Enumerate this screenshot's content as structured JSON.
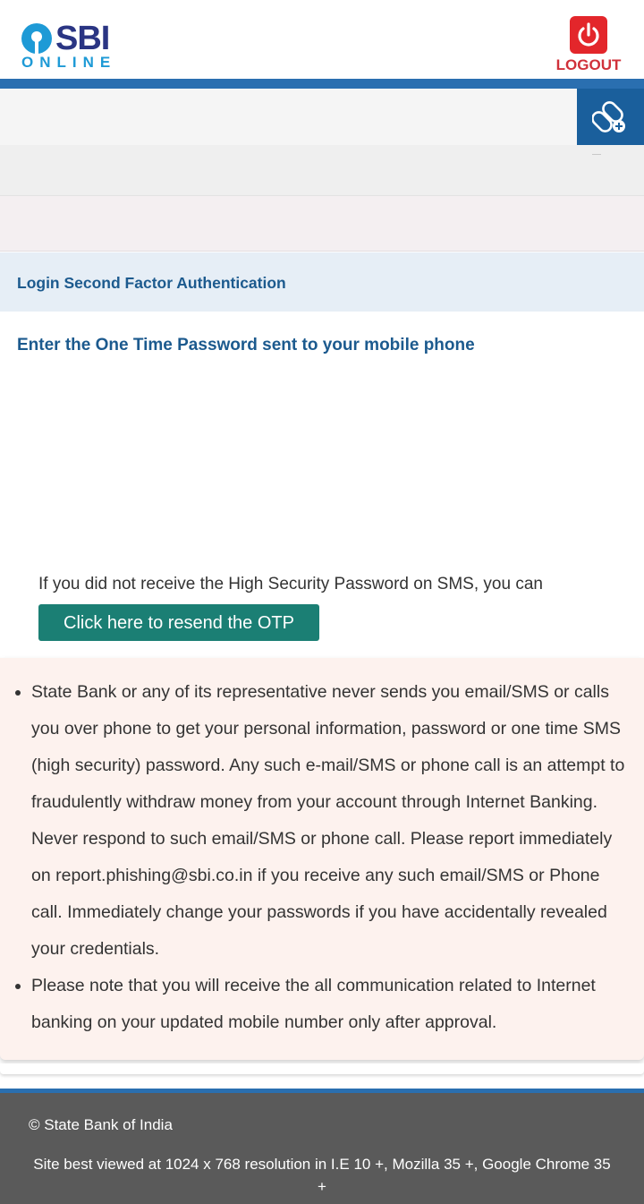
{
  "header": {
    "logo_top": "SBI",
    "logo_bottom": "ONLINE",
    "logout_label": "LOGOUT"
  },
  "auth": {
    "section_title": "Login Second Factor Authentication",
    "otp_heading": "Enter the One Time Password sent to your mobile phone",
    "resend_prompt": "If you did not receive the High Security Password on SMS, you can",
    "resend_button": "Click here to resend the OTP"
  },
  "notice": {
    "items": [
      "State Bank or any of its representative never sends you email/SMS or calls you over phone to get your personal information, password or one time SMS (high security) password. Any such e-mail/SMS or phone call is an attempt to fraudulently withdraw money from your account through Internet Banking. Never respond to such email/SMS or phone call. Please report immediately on report.phishing@sbi.co.in if you receive any such email/SMS or Phone call. Immediately change your passwords if you have accidentally revealed your credentials.",
      "Please note that you will receive the all communication related to Internet banking on your updated mobile number only after approval."
    ]
  },
  "footer": {
    "copyright": "© State Bank of India",
    "best_viewed": "Site best viewed at 1024 x 768 resolution in I.E 10 +, Mozilla 35 +, Google Chrome 35 +"
  },
  "icons": {
    "logout": "power-icon",
    "link": "link-add-icon"
  },
  "colors": {
    "brand_blue": "#2a6fb0",
    "logout_red": "#e3262b",
    "button_teal": "#1b7f74",
    "notice_bg": "#fdf2ee",
    "footer_bg": "#5a5a5a"
  }
}
